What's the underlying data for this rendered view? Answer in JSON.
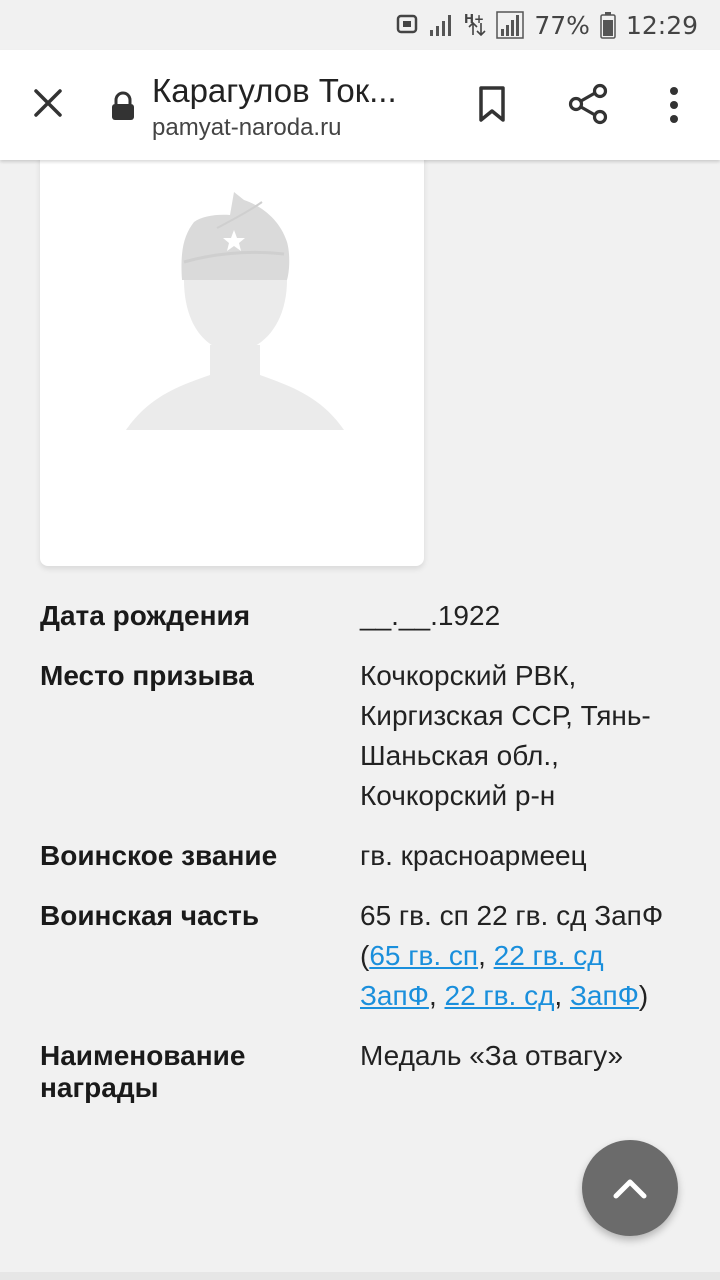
{
  "status_bar": {
    "battery_percent": "77%",
    "time": "12:29"
  },
  "toolbar": {
    "page_title": "Карагулов Ток...",
    "url": "pamyat-naroda.ru"
  },
  "details": [
    {
      "label": "Дата рождения",
      "value": "__.__.1922"
    },
    {
      "label": "Место призыва",
      "value": "Кочкорский РВК, Киргизская ССР, Тянь-Шаньская обл., Кочкорский р-н"
    },
    {
      "label": "Воинское звание",
      "value": "гв. красноармеец"
    },
    {
      "label": "Воинская часть",
      "value_prefix": "65 гв. сп 22 гв. сд ЗапФ (",
      "links": [
        "65 гв. сп",
        "22 гв. сд ЗапФ",
        "22 гв. сд",
        "ЗапФ"
      ],
      "value_suffix": ")"
    },
    {
      "label": "Наименование награды",
      "value": "Медаль «За отвагу»"
    }
  ],
  "colors": {
    "link": "#1a8fdc",
    "background": "#f1f1f1"
  }
}
